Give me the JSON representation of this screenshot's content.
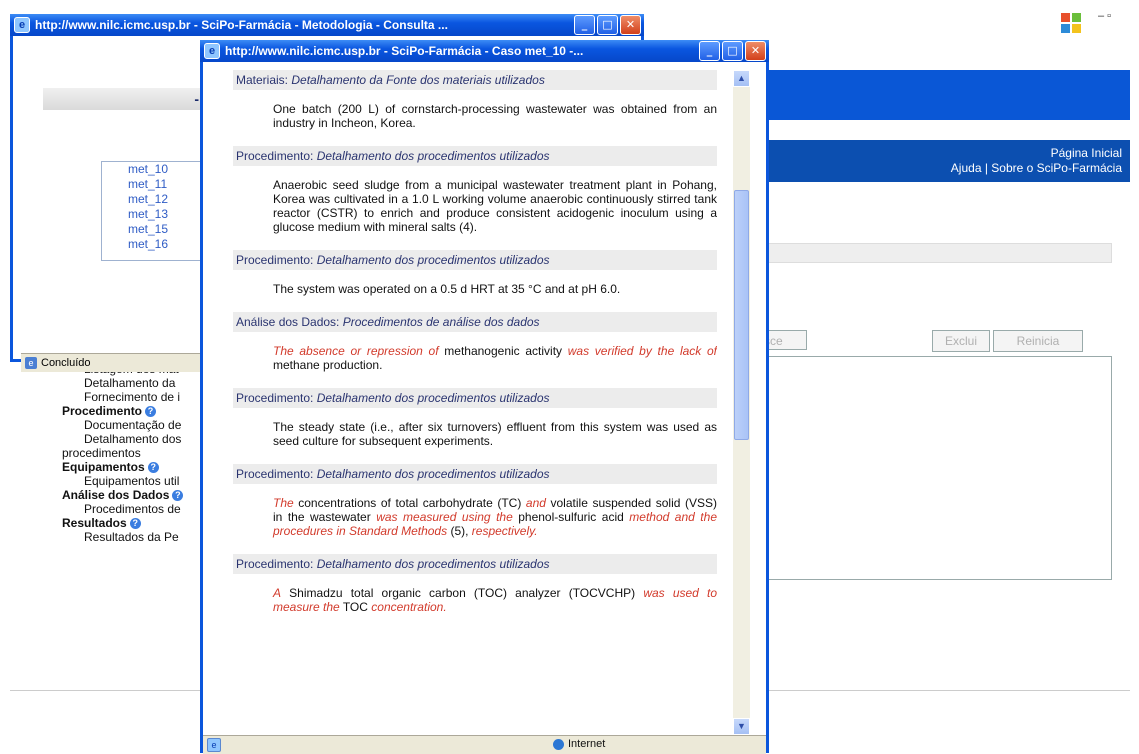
{
  "win1": {
    "title": "http://www.nilc.icmc.usp.br - SciPo-Farmácia - Metodologia - Consulta ...",
    "nav_label": "- N",
    "list": [
      "met_10",
      "met_11",
      "met_12",
      "met_13",
      "met_15",
      "met_16"
    ],
    "status": "Concluído"
  },
  "page": {
    "links": [
      "Página Inicial",
      "Ajuda | Sobre o SciPo-Farmácia"
    ],
    "buttons": {
      "busca": "sce",
      "exclui": "Exclui",
      "reinicia": "Reinicia"
    },
    "tree": [
      {
        "type": "sub",
        "text": "Listagem dos mat"
      },
      {
        "type": "sub",
        "text": "Detalhamento da"
      },
      {
        "type": "sub",
        "text": "Fornecimento de i"
      },
      {
        "type": "sec",
        "text": "Procedimento"
      },
      {
        "type": "sub",
        "text": "Documentação de"
      },
      {
        "type": "sub",
        "text": "Detalhamento dos"
      },
      {
        "type": "full",
        "text": "procedimentos"
      },
      {
        "type": "sec",
        "text": "Equipamentos"
      },
      {
        "type": "sub",
        "text": "Equipamentos util"
      },
      {
        "type": "sec",
        "text": "Análise dos Dados"
      },
      {
        "type": "sub",
        "text": "Procedimentos de"
      },
      {
        "type": "sec",
        "text": "Resultados"
      },
      {
        "type": "sub",
        "text": "Resultados da Pe"
      }
    ]
  },
  "win2": {
    "title": "http://www.nilc.icmc.usp.br - SciPo-Farmácia - Caso met_10 -...",
    "status_zone": "Internet",
    "sections": [
      {
        "label": "Materiais:",
        "desc": "Detalhamento da Fonte dos materiais utilizados",
        "body": [
          {
            "t": "One batch (200 L) of cornstarch-processing wastewater was obtained from an industry in Incheon, Korea.",
            "red": false
          }
        ]
      },
      {
        "label": "Procedimento:",
        "desc": "Detalhamento dos procedimentos utilizados",
        "body": [
          {
            "t": "Anaerobic seed sludge from a municipal wastewater treatment plant in Pohang, Korea was cultivated in a 1.0 L working volume anaerobic continuously stirred tank reactor (CSTR) to enrich and produce consistent acidogenic inoculum using a glucose medium with mineral salts (4).",
            "red": false
          }
        ]
      },
      {
        "label": "Procedimento:",
        "desc": "Detalhamento dos procedimentos utilizados",
        "body": [
          {
            "t": "The system was operated on a 0.5 d HRT at 35 °C and at pH 6.0.",
            "red": false
          }
        ]
      },
      {
        "label": "Análise dos Dados:",
        "desc": "Procedimentos de análise dos dados",
        "body": [
          {
            "t": "The absence or repression of",
            "red": true
          },
          {
            "t": " methanogenic activity ",
            "red": false
          },
          {
            "t": "was verified by the lack of",
            "red": true
          },
          {
            "t": " methane production.",
            "red": false
          }
        ]
      },
      {
        "label": "Procedimento:",
        "desc": "Detalhamento dos procedimentos utilizados",
        "body": [
          {
            "t": "The steady state (i.e., after six turnovers) effluent from this system was used as seed culture for subsequent experiments.",
            "red": false
          }
        ]
      },
      {
        "label": "Procedimento:",
        "desc": "Detalhamento dos procedimentos utilizados",
        "body": [
          {
            "t": "The",
            "red": true
          },
          {
            "t": " concentrations of total carbohydrate (TC) ",
            "red": false
          },
          {
            "t": "and",
            "red": true
          },
          {
            "t": " volatile suspended solid (VSS) in the wastewater ",
            "red": false
          },
          {
            "t": "was measured using the",
            "red": true
          },
          {
            "t": " phenol-sulfuric acid ",
            "red": false
          },
          {
            "t": "method and the procedures in Standard Methods",
            "red": true
          },
          {
            "t": " (5), ",
            "red": false
          },
          {
            "t": "respectively.",
            "red": true
          }
        ]
      },
      {
        "label": "Procedimento:",
        "desc": "Detalhamento dos procedimentos utilizados",
        "body": [
          {
            "t": "A",
            "red": true
          },
          {
            "t": " Shimadzu total organic carbon (TOC) analyzer (TOCVCHP) ",
            "red": false
          },
          {
            "t": "was used to measure the",
            "red": true
          },
          {
            "t": " TOC ",
            "red": false
          },
          {
            "t": "concentration.",
            "red": true
          }
        ]
      }
    ]
  },
  "colors": {
    "xp_blue": "#0a56e0",
    "accent_red": "#d23a2b",
    "page_blue": "#0a57d6"
  }
}
